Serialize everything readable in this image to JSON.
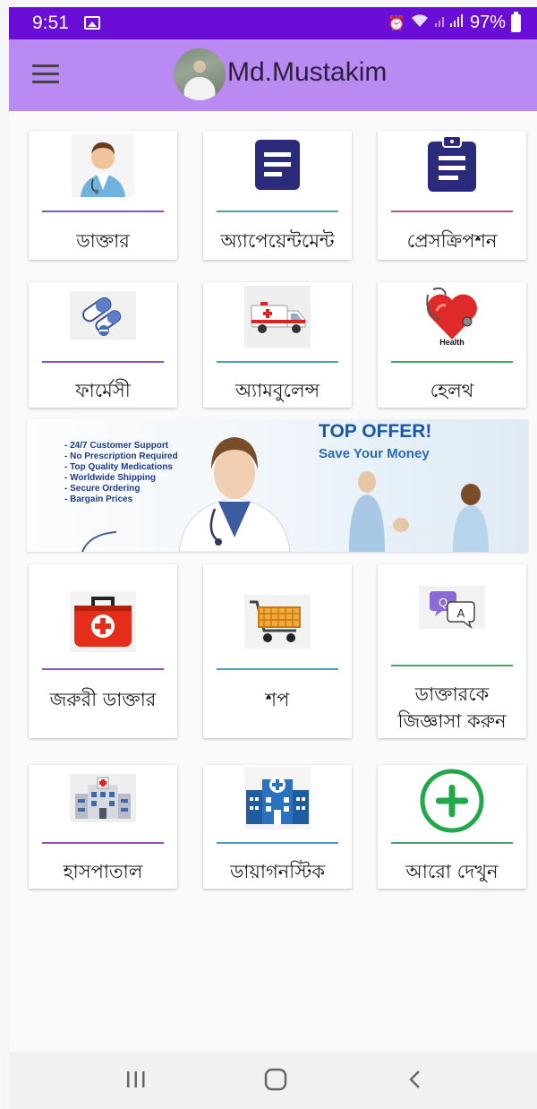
{
  "status_bar": {
    "time": "9:51",
    "battery": "97%"
  },
  "toolbar": {
    "user_name": "Md.Mustakim"
  },
  "grid_row1": [
    {
      "label": "ডাক্তার"
    },
    {
      "label": "অ্যাপেয়েন্টমেন্ট"
    },
    {
      "label": "প্রেসক্রিপশন"
    }
  ],
  "grid_row2": [
    {
      "label": "ফার্মেসী"
    },
    {
      "label": "অ্যামবুলেন্স"
    },
    {
      "label": "হেলথ",
      "icon_caption": "Health"
    }
  ],
  "banner": {
    "title": "TOP OFFER!",
    "subtitle": "Save Your Money",
    "features": [
      "24/7 Customer Support",
      "No Prescription Required",
      "Top Quality Medications",
      "Worldwide Shipping",
      "Secure Ordering",
      "Bargain Prices"
    ]
  },
  "grid_row3": [
    {
      "label": "জরুরী ডাক্তার"
    },
    {
      "label": "শপ"
    },
    {
      "label_line1": "ডাক্তারকে",
      "label_line2": "জিজ্ঞাসা করুন",
      "icon_q": "Q",
      "icon_a": "A"
    }
  ],
  "grid_row4": [
    {
      "label": "হাসপাতাল"
    },
    {
      "label": "ডায়াগনস্টিক"
    },
    {
      "label": "আরো দেখুন"
    }
  ],
  "colors": {
    "status_bar": "#6a0dd6",
    "toolbar": "#b98bf2",
    "icon_navy": "#2c2a7a",
    "plus_green": "#22a84a"
  }
}
